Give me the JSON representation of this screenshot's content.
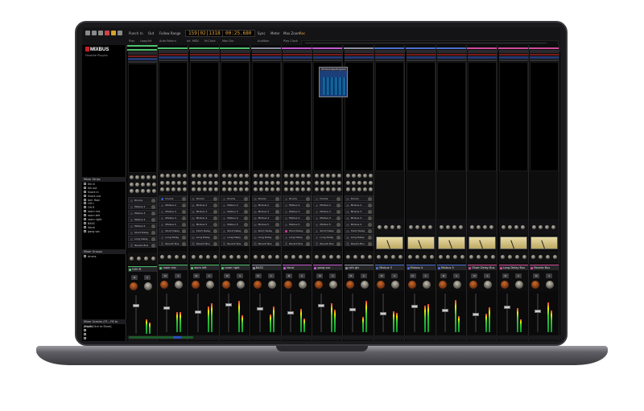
{
  "toolbar": {
    "menu_items": [
      "Punch",
      "In",
      "Out",
      "Follow Range",
      "Sync"
    ],
    "clock_bbt": "159|02|1318",
    "clock_time": "00:25.680",
    "sub_labels": [
      "Play",
      "Loop/Int",
      "Auto Return",
      "Int. MIDI",
      "M:Clock",
      "Max Dur"
    ],
    "right_labels": [
      "Meter",
      "Audition",
      "Rec",
      "Mon",
      "Play Clock",
      "Max Zoom"
    ]
  },
  "sidebar": {
    "logo": "MIXBUS",
    "favorites_label": "Favorite Plugins",
    "strips_header": "Mixer Strips",
    "strips": [
      "Kik in",
      "Kik out",
      "Snare in",
      "Snare out",
      "tom floor",
      "OH L",
      "OH R",
      "room mic",
      "room left",
      "room right",
      "BASS",
      "Vocal",
      "gang voc"
    ],
    "groups_header": "Mixer Groups",
    "groups": [
      "drums"
    ],
    "scenes_header": "Mixer Scenes (F1...F8 to recall)",
    "scenes": [
      "[Right-Click to Store]"
    ]
  },
  "strips": [
    {
      "name": "OVH R",
      "type": "track",
      "color": "#4ec06a"
    },
    {
      "name": "room mic",
      "type": "track",
      "color": "#4ec06a"
    },
    {
      "name": "room left",
      "type": "track",
      "color": "#4ec06a"
    },
    {
      "name": "room right",
      "type": "track",
      "color": "#4ec06a"
    },
    {
      "name": "BASS",
      "type": "track",
      "color": "#8a8fa0"
    },
    {
      "name": "Vocal",
      "type": "track",
      "color": "#c25ad0"
    },
    {
      "name": "gang voc",
      "type": "track",
      "color": "#c25ad0"
    },
    {
      "name": "ryth gtr",
      "type": "track",
      "color": "#8a8fa0"
    },
    {
      "name": "Mixbus 3",
      "type": "bus",
      "color": "#4a6fd0"
    },
    {
      "name": "Mixbus 4",
      "type": "bus",
      "color": "#4a6fd0"
    },
    {
      "name": "Mixbus 5",
      "type": "bus",
      "color": "#4a6fd0"
    },
    {
      "name": "Short Delay Bus",
      "type": "bus",
      "color": "#d04a9a"
    },
    {
      "name": "Long Delay Bus",
      "type": "bus",
      "color": "#d04a9a"
    },
    {
      "name": "Reverb Bus",
      "type": "bus",
      "color": "#d04a9a"
    }
  ],
  "sends": [
    "Drums",
    "Mixbus 2",
    "Mixbus 3",
    "Mixbus 4",
    "Mixbus 5",
    "Short Delay",
    "Long Delay",
    "Reverb Bus"
  ],
  "popup": {
    "title": "XT-Voice Spectrogram"
  },
  "buttons": {
    "mute": "M",
    "solo": "S"
  },
  "colors": {
    "accent_red": "#c8202a",
    "clock": "#e2a23a",
    "selected_strip": "#2a5ad0"
  }
}
